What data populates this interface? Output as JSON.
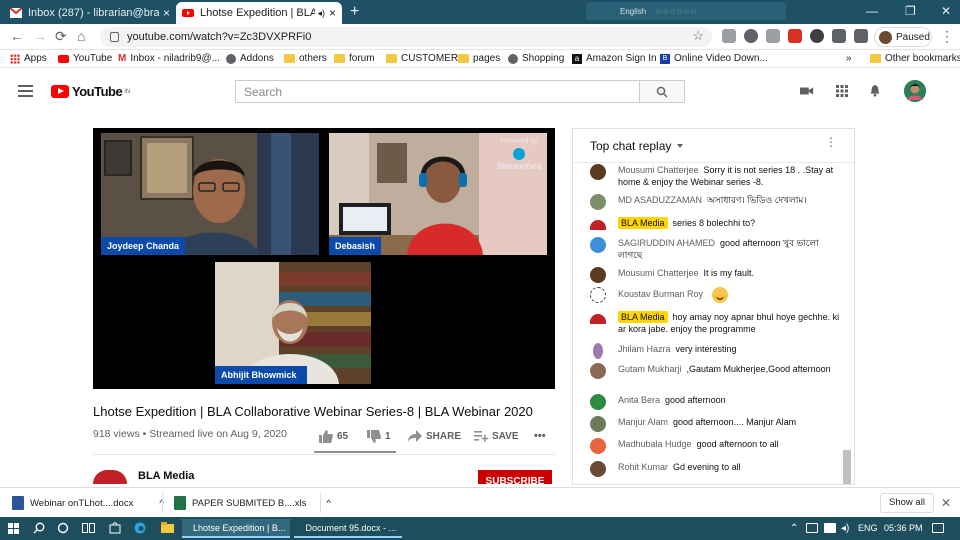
{
  "browser": {
    "tabs": [
      {
        "title": "Inbox (287) - librarian@brainwar...",
        "close": "×",
        "favicon_color": "#d93025"
      },
      {
        "title": "Lhotse Expedition | BLA Colla...",
        "close": "×",
        "favicon_color": "#ff0000"
      }
    ],
    "new_tab": "+",
    "ext_text": "English",
    "window_controls": [
      "—",
      "❐",
      "✕"
    ],
    "nav": {
      "back": "←",
      "forward": "→",
      "reload": "⟳",
      "home": "⌂"
    },
    "url": "youtube.com/watch?v=Zc3DVXPRFi0",
    "star": "☆",
    "profile_label": "Paused",
    "menu": "⋮",
    "bookmarks": [
      {
        "label": "Apps",
        "icon": "apps-icon"
      },
      {
        "label": "YouTube",
        "icon": "youtube-icon"
      },
      {
        "label": "Inbox - niladrib9@...",
        "icon": "gmail-icon"
      },
      {
        "label": "Addons",
        "icon": "globe-icon"
      },
      {
        "label": "others",
        "icon": "folder-icon"
      },
      {
        "label": "forum",
        "icon": "folder-icon"
      },
      {
        "label": "CUSTOMER",
        "icon": "folder-icon"
      },
      {
        "label": "pages",
        "icon": "folder-icon"
      },
      {
        "label": "Shopping",
        "icon": "globe-icon"
      },
      {
        "label": "Amazon Sign In",
        "icon": "amazon-icon"
      },
      {
        "label": "Online Video Down...",
        "icon": "bookmark-icon"
      }
    ],
    "bookmarks_more": "»",
    "other_bookmarks": "Other bookmarks"
  },
  "youtube": {
    "logo_word": "YouTube",
    "logo_region": "IN",
    "search_placeholder": "Search",
    "search_icon": "⚲",
    "header_icons": {
      "create": "▶",
      "apps": "⋮⋮",
      "bell": "🔔"
    }
  },
  "video": {
    "participants": [
      {
        "name": "Joydeep Chanda"
      },
      {
        "name": "Debasish"
      },
      {
        "name": "Abhijit Bhowmick"
      }
    ],
    "watermark_line1": "Powered by",
    "watermark_line2": "StreamYard",
    "title": "Lhotse Expedition | BLA Collaborative Webinar Series-8 | BLA Webinar 2020",
    "meta": "918 views • Streamed live on Aug 9, 2020",
    "likes": "65",
    "dislikes": "1",
    "share": "SHARE",
    "save": "SAVE",
    "more": "•••",
    "channel": "BLA Media",
    "subscribe": "SUBSCRIBE"
  },
  "chat": {
    "header": "Top chat replay",
    "kebab": "⋮",
    "messages": [
      {
        "author": "Mousumi Chatterjee",
        "text": "Sorry it is not series 18 . .Stay at home & enjoy the Webinar series -8.",
        "avatar_color": "#5a3a22"
      },
      {
        "author": "MD ASADUZZAMAN",
        "text": "অসাধারণ। ভিডিও দেখলাম।",
        "avatar_color": "#7d8f6a"
      },
      {
        "author": "BLA Media",
        "text": "series 8 bolechhi to?",
        "mod": true,
        "avatar_color": "#c02026"
      },
      {
        "author": "SAGIRUDDIN AHAMED",
        "text": "good afternoon খুব ভালো লাগছে",
        "avatar_color": "#3d8fd6"
      },
      {
        "author": "Mousumi Chatterjee",
        "text": "It is my fault.",
        "avatar_color": "#5a3a22"
      },
      {
        "author": "Koustav Burman Roy",
        "text": "",
        "emoji": "smile",
        "avatar_color": "#444444"
      },
      {
        "author": "BLA Media",
        "text": "hoy amay noy apnar bhul hoye gechhe. ki ar kora jabe. enjoy the programme",
        "mod": true,
        "avatar_color": "#c02026"
      },
      {
        "author": "Jhilam Hazra",
        "text": "very interesting",
        "avatar_color": "#9c7ab0"
      },
      {
        "author": "Gutam Mukharji",
        "text": ",Gautam Mukherjee,Good afternoon",
        "avatar_color": "#8a6a55"
      },
      {
        "author": "Anita Bera",
        "text": "good afternoon",
        "avatar_color": "#2e8b3e"
      },
      {
        "author": "Manjur Alam",
        "text": "good afternoon.... Manjur Alam",
        "avatar_color": "#6d7b5a"
      },
      {
        "author": "Madhubala Hudge",
        "text": "good afternoon to all",
        "avatar_color": "#e8643c"
      },
      {
        "author": "Rohit Kumar",
        "text": "Gd evening to all",
        "avatar_color": "#6a4a34"
      }
    ]
  },
  "downloads": {
    "items": [
      {
        "name": "Webinar onTLhot....docx",
        "color": "#2b579a"
      },
      {
        "name": "PAPER SUBMITED B....xls",
        "color": "#217346"
      }
    ],
    "chevron": "^",
    "show_all": "Show all",
    "close": "✕"
  },
  "taskbar": {
    "apps": [
      {
        "label": "Lhotse Expedition | B...",
        "icon": "chrome-icon"
      },
      {
        "label": "Document 95.docx - ...",
        "icon": "word-icon"
      }
    ],
    "lang": "ENG",
    "time": "05:36 PM"
  }
}
